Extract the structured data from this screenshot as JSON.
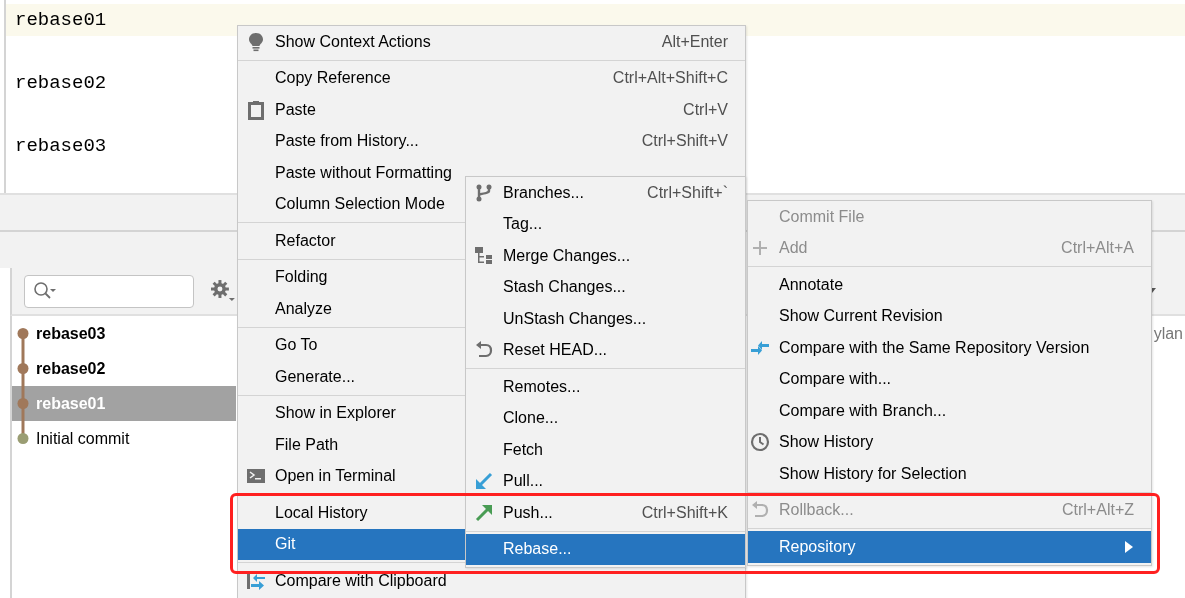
{
  "editor": {
    "lines": [
      {
        "text": "rebase01",
        "current": true
      },
      {
        "text": "rebase02",
        "current": false
      },
      {
        "text": "rebase03",
        "current": false
      }
    ]
  },
  "log": {
    "commits": [
      {
        "label": "rebase03",
        "bold": true,
        "selected": false,
        "color": "#a0785a"
      },
      {
        "label": "rebase02",
        "bold": true,
        "selected": false,
        "color": "#a0785a"
      },
      {
        "label": "rebase01",
        "bold": true,
        "selected": true,
        "color": "#a0785a"
      },
      {
        "label": "Initial commit",
        "bold": false,
        "selected": false,
        "color": "#9a9d73"
      }
    ],
    "author_cell": "ylan"
  },
  "menus": [
    {
      "items": [
        {
          "kind": "item",
          "label": "Show Context Actions",
          "shortcut": "Alt+Enter",
          "disabled": false,
          "selected": false
        },
        {
          "kind": "separator"
        },
        {
          "kind": "item",
          "label": "Copy Reference",
          "shortcut": "Ctrl+Alt+Shift+C",
          "disabled": false,
          "selected": false
        },
        {
          "kind": "item",
          "label": "Paste",
          "shortcut": "Ctrl+V",
          "disabled": false,
          "selected": false
        },
        {
          "kind": "item",
          "label": "Paste from History...",
          "shortcut": "Ctrl+Shift+V",
          "disabled": false,
          "selected": false
        },
        {
          "kind": "item",
          "label": "Paste without Formatting",
          "disabled": false,
          "selected": false
        },
        {
          "kind": "item",
          "label": "Column Selection Mode",
          "disabled": false,
          "selected": false
        },
        {
          "kind": "separator"
        },
        {
          "kind": "item",
          "label": "Refactor",
          "disabled": false,
          "selected": false
        },
        {
          "kind": "separator"
        },
        {
          "kind": "item",
          "label": "Folding",
          "disabled": false,
          "selected": false
        },
        {
          "kind": "item",
          "label": "Analyze",
          "disabled": false,
          "selected": false
        },
        {
          "kind": "separator"
        },
        {
          "kind": "item",
          "label": "Go To",
          "disabled": false,
          "selected": false
        },
        {
          "kind": "item",
          "label": "Generate...",
          "disabled": false,
          "selected": false
        },
        {
          "kind": "separator"
        },
        {
          "kind": "item",
          "label": "Show in Explorer",
          "disabled": false,
          "selected": false
        },
        {
          "kind": "item",
          "label": "File Path",
          "disabled": false,
          "selected": false
        },
        {
          "kind": "item",
          "label": "Open in Terminal",
          "disabled": false,
          "selected": false
        },
        {
          "kind": "separator"
        },
        {
          "kind": "item",
          "label": "Local History",
          "disabled": false,
          "selected": false
        },
        {
          "kind": "item",
          "label": "Git",
          "disabled": false,
          "selected": true
        },
        {
          "kind": "separator"
        },
        {
          "kind": "item",
          "label": "Compare with Clipboard",
          "disabled": false,
          "selected": false
        }
      ]
    },
    {
      "items": [
        {
          "kind": "item",
          "label": "Branches...",
          "shortcut": "Ctrl+Shift+`",
          "disabled": false,
          "selected": false
        },
        {
          "kind": "item",
          "label": "Tag...",
          "disabled": false,
          "selected": false
        },
        {
          "kind": "item",
          "label": "Merge Changes...",
          "disabled": false,
          "selected": false
        },
        {
          "kind": "item",
          "label": "Stash Changes...",
          "disabled": false,
          "selected": false
        },
        {
          "kind": "item",
          "label": "UnStash Changes...",
          "disabled": false,
          "selected": false
        },
        {
          "kind": "item",
          "label": "Reset HEAD...",
          "disabled": false,
          "selected": false
        },
        {
          "kind": "separator"
        },
        {
          "kind": "item",
          "label": "Remotes...",
          "disabled": false,
          "selected": false
        },
        {
          "kind": "item",
          "label": "Clone...",
          "disabled": false,
          "selected": false
        },
        {
          "kind": "item",
          "label": "Fetch",
          "disabled": false,
          "selected": false
        },
        {
          "kind": "item",
          "label": "Pull...",
          "disabled": false,
          "selected": false
        },
        {
          "kind": "item",
          "label": "Push...",
          "shortcut": "Ctrl+Shift+K",
          "disabled": false,
          "selected": false
        },
        {
          "kind": "separator"
        },
        {
          "kind": "item",
          "label": "Rebase...",
          "disabled": false,
          "selected": true
        }
      ]
    },
    {
      "items": [
        {
          "kind": "item",
          "label": "Commit File",
          "disabled": true,
          "selected": false,
          "submenu": false
        },
        {
          "kind": "item",
          "label": "Add",
          "shortcut": "Ctrl+Alt+A",
          "disabled": true,
          "selected": false,
          "submenu": false
        },
        {
          "kind": "separator"
        },
        {
          "kind": "item",
          "label": "Annotate",
          "disabled": false,
          "selected": false,
          "submenu": false
        },
        {
          "kind": "item",
          "label": "Show Current Revision",
          "disabled": false,
          "selected": false,
          "submenu": false
        },
        {
          "kind": "item",
          "label": "Compare with the Same Repository Version",
          "disabled": false,
          "selected": false,
          "submenu": false
        },
        {
          "kind": "item",
          "label": "Compare with...",
          "disabled": false,
          "selected": false,
          "submenu": false
        },
        {
          "kind": "item",
          "label": "Compare with Branch...",
          "disabled": false,
          "selected": false,
          "submenu": false
        },
        {
          "kind": "item",
          "label": "Show History",
          "disabled": false,
          "selected": false,
          "submenu": false
        },
        {
          "kind": "item",
          "label": "Show History for Selection",
          "disabled": false,
          "selected": false,
          "submenu": false
        },
        {
          "kind": "separator"
        },
        {
          "kind": "item",
          "label": "Rollback...",
          "shortcut": "Ctrl+Alt+Z",
          "disabled": true,
          "selected": false,
          "submenu": false
        },
        {
          "kind": "separator"
        },
        {
          "kind": "item",
          "label": "Repository",
          "disabled": false,
          "selected": true,
          "submenu": true
        }
      ]
    }
  ]
}
